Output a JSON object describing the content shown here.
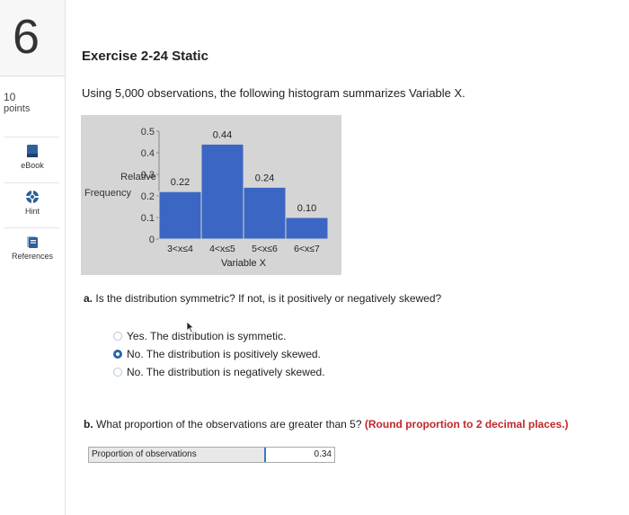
{
  "question": {
    "number": "6",
    "points_value": "10",
    "points_label": "points"
  },
  "tools": [
    {
      "label": "eBook",
      "icon": "ebook-icon"
    },
    {
      "label": "Hint",
      "icon": "hint-icon"
    },
    {
      "label": "References",
      "icon": "references-icon"
    }
  ],
  "exercise": {
    "title": "Exercise 2-24 Static",
    "intro": "Using 5,000 observations, the following histogram summarizes Variable X."
  },
  "chart_data": {
    "type": "bar",
    "categories": [
      "3<x≤4",
      "4<x≤5",
      "5<x≤6",
      "6<x≤7"
    ],
    "values": [
      0.22,
      0.44,
      0.24,
      0.1
    ],
    "data_labels": [
      "0.22",
      "0.44",
      "0.24",
      "0.10"
    ],
    "xlabel": "Variable X",
    "ylabel_line1": "Relative",
    "ylabel_line2": "Frequency",
    "yticks": [
      "0",
      "0.1",
      "0.2",
      "0.3",
      "0.4",
      "0.5"
    ],
    "ylim": [
      0,
      0.5
    ],
    "bar_color": "#3b66c4",
    "background_color": "#d5d5d5"
  },
  "part_a": {
    "prefix": "a.",
    "question": "Is the distribution symmetric? If not, is it positively or negatively skewed?",
    "options": [
      {
        "label": "Yes. The distribution is symmetic.",
        "selected": false
      },
      {
        "label": "No. The distribution is positively skewed.",
        "selected": true
      },
      {
        "label": "No. The distribution is negatively skewed.",
        "selected": false
      }
    ]
  },
  "part_b": {
    "prefix": "b.",
    "question": "What proportion of the observations are greater than 5?",
    "instruction": "(Round proportion to 2 decimal places.)",
    "answer_label": "Proportion of observations",
    "answer_value": "0.34"
  },
  "colors": {
    "accent": "#2a64a6",
    "instruction_red": "#c0282a"
  }
}
